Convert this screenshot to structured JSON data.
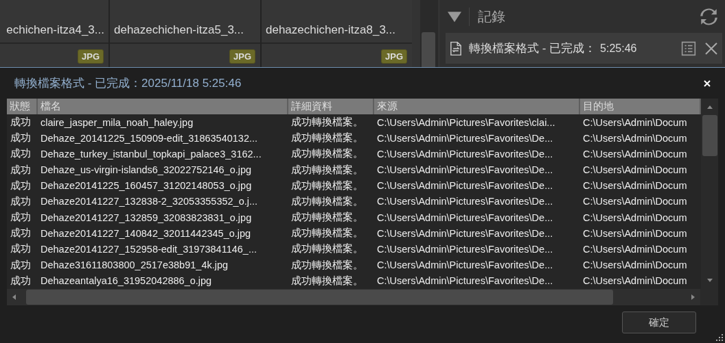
{
  "background": {
    "thumbnails": [
      {
        "name": "echichen-itza4_3...",
        "badge": "JPG"
      },
      {
        "name": "dehazechichen-itza5_3...",
        "badge": "JPG"
      },
      {
        "name": "dehazechichen-itza8_3...",
        "badge": "JPG"
      }
    ],
    "log_panel": {
      "title": "記錄",
      "expanded": true,
      "task": {
        "title": "轉換檔案格式 - 已完成：",
        "time": "5:25:46"
      }
    }
  },
  "dialog": {
    "title": "轉換檔案格式 - 已完成：2025/11/18 5:25:46",
    "table": {
      "columns": [
        "狀態",
        "檔名",
        "詳細資料",
        "來源",
        "目的地"
      ],
      "rows": [
        [
          "成功",
          "claire_jasper_mila_noah_haley.jpg",
          "成功轉換檔案。",
          "C:\\Users\\Admin\\Pictures\\Favorites\\clai...",
          "C:\\Users\\Admin\\Docum"
        ],
        [
          "成功",
          "Dehaze_20141225_150909-edit_31863540132...",
          "成功轉換檔案。",
          "C:\\Users\\Admin\\Pictures\\Favorites\\De...",
          "C:\\Users\\Admin\\Docum"
        ],
        [
          "成功",
          "Dehaze_turkey_istanbul_topkapi_palace3_3162...",
          "成功轉換檔案。",
          "C:\\Users\\Admin\\Pictures\\Favorites\\De...",
          "C:\\Users\\Admin\\Docum"
        ],
        [
          "成功",
          "Dehaze_us-virgin-islands6_32022752146_o.jpg",
          "成功轉換檔案。",
          "C:\\Users\\Admin\\Pictures\\Favorites\\De...",
          "C:\\Users\\Admin\\Docum"
        ],
        [
          "成功",
          "Dehaze20141225_160457_31202148053_o.jpg",
          "成功轉換檔案。",
          "C:\\Users\\Admin\\Pictures\\Favorites\\De...",
          "C:\\Users\\Admin\\Docum"
        ],
        [
          "成功",
          "Dehaze20141227_132838-2_32053355352_o.j...",
          "成功轉換檔案。",
          "C:\\Users\\Admin\\Pictures\\Favorites\\De...",
          "C:\\Users\\Admin\\Docum"
        ],
        [
          "成功",
          "Dehaze20141227_132859_32083823831_o.jpg",
          "成功轉換檔案。",
          "C:\\Users\\Admin\\Pictures\\Favorites\\De...",
          "C:\\Users\\Admin\\Docum"
        ],
        [
          "成功",
          "Dehaze20141227_140842_32011442345_o.jpg",
          "成功轉換檔案。",
          "C:\\Users\\Admin\\Pictures\\Favorites\\De...",
          "C:\\Users\\Admin\\Docum"
        ],
        [
          "成功",
          "Dehaze20141227_152958-edit_31973841146_...",
          "成功轉換檔案。",
          "C:\\Users\\Admin\\Pictures\\Favorites\\De...",
          "C:\\Users\\Admin\\Docum"
        ],
        [
          "成功",
          "Dehaze31611803800_2517e38b91_4k.jpg",
          "成功轉換檔案。",
          "C:\\Users\\Admin\\Pictures\\Favorites\\De...",
          "C:\\Users\\Admin\\Docum"
        ],
        [
          "成功",
          "Dehazeantalya16_31952042886_o.jpg",
          "成功轉換檔案。",
          "C:\\Users\\Admin\\Pictures\\Favorites\\De...",
          "C:\\Users\\Admin\\Docum"
        ]
      ]
    },
    "buttons": [
      "確定"
    ]
  }
}
